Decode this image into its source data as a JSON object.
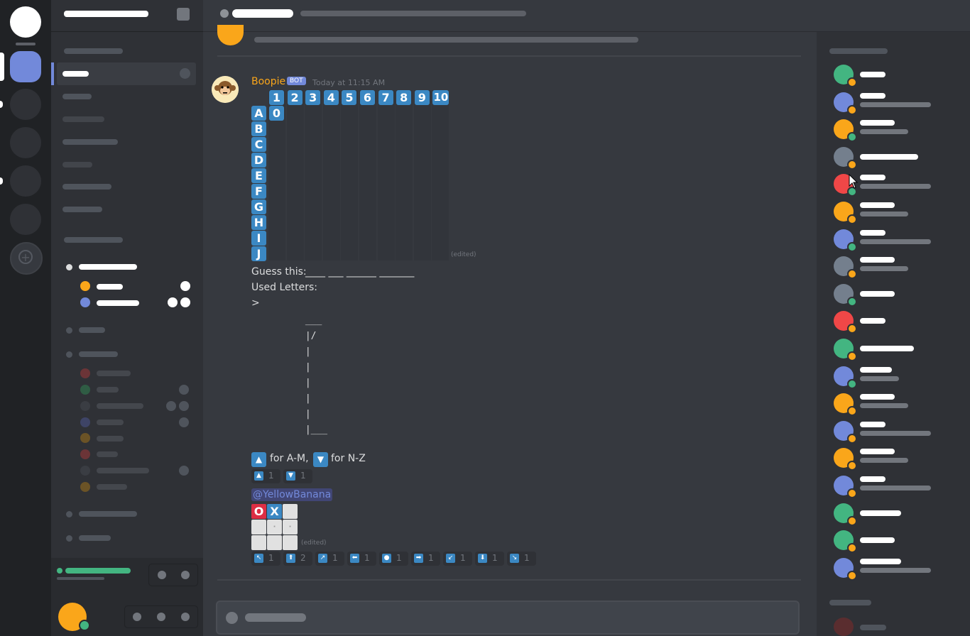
{
  "message": {
    "author": "Boopie",
    "bot_tag": "BOT",
    "timestamp": "Today at 11:15 AM",
    "board": {
      "column_labels": [
        "1",
        "2",
        "3",
        "4",
        "5",
        "6",
        "7",
        "8",
        "9",
        "10"
      ],
      "row_labels": [
        "A",
        "B",
        "C",
        "D",
        "E",
        "F",
        "G",
        "H",
        "I",
        "J"
      ],
      "cell_A1": "0",
      "edited": "(edited)"
    },
    "guess_label": "Guess this:",
    "guess_blanks": "____ ___ ______ _______",
    "used_letters": "Used Letters:",
    "prompt": ">",
    "gallows": [
      " ___",
      " |/",
      " |",
      " |",
      " |",
      " |",
      " |",
      " |___"
    ],
    "reaction_hint": {
      "up_text": "for A-M,",
      "down_text": "for N-Z"
    },
    "reactions_1": [
      {
        "icon": "arrow-up-icon",
        "glyph": "▲",
        "count": "1"
      },
      {
        "icon": "arrow-down-icon",
        "glyph": "▼",
        "count": "1"
      }
    ],
    "mention": "@YellowBanana",
    "tictactoe": {
      "o": "O",
      "x": "X",
      "edited": "(edited)"
    },
    "reactions_2": [
      {
        "icon": "arrow-upper-left-icon",
        "glyph": "↖",
        "count": "1"
      },
      {
        "icon": "arrow-up-icon",
        "glyph": "⬆",
        "count": "2"
      },
      {
        "icon": "arrow-upper-right-icon",
        "glyph": "↗",
        "count": "1"
      },
      {
        "icon": "arrow-left-icon",
        "glyph": "⬅",
        "count": "1"
      },
      {
        "icon": "circle-icon",
        "glyph": "●",
        "count": "1"
      },
      {
        "icon": "arrow-right-icon",
        "glyph": "➡",
        "count": "1"
      },
      {
        "icon": "arrow-lower-left-icon",
        "glyph": "↙",
        "count": "1"
      },
      {
        "icon": "arrow-down-icon",
        "glyph": "⬇",
        "count": "1"
      },
      {
        "icon": "arrow-lower-right-icon",
        "glyph": "↘",
        "count": "1"
      }
    ]
  },
  "colors": {
    "author": "#faa61a",
    "bot_tag": "#7289da",
    "keycap": "#3b88c3",
    "o_tile": "#dd2e44",
    "online": "#43b581",
    "idle": "#faa61a",
    "mention_bg": "#414675",
    "mention_text": "#7289da"
  }
}
